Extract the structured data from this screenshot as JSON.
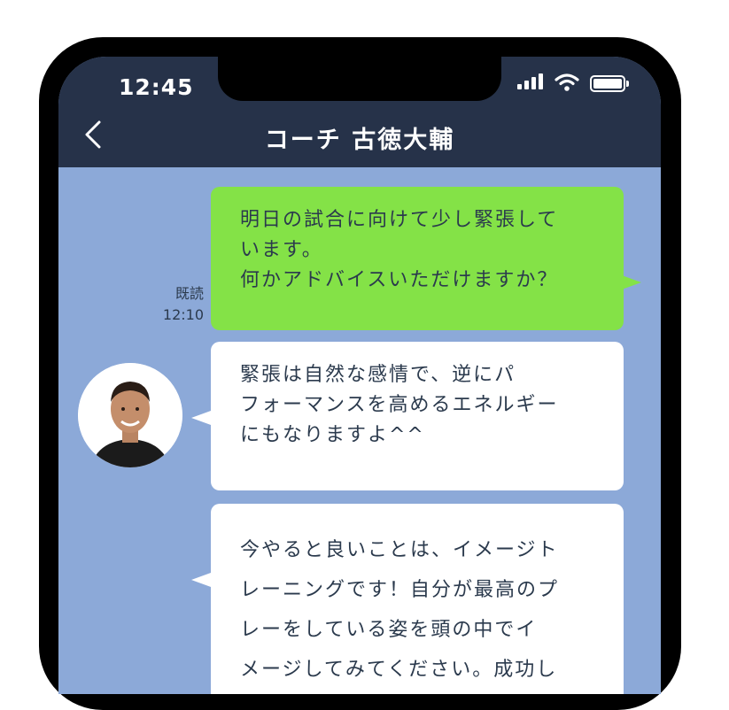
{
  "status_bar": {
    "time": "12:45"
  },
  "header": {
    "title": "コーチ 古徳大輔"
  },
  "messages": [
    {
      "side": "sent",
      "text": "明日の試合に向けて少し緊張して\nいます。\n何かアドバイスいただけますか？",
      "read_label": "既読",
      "time": "12:10"
    },
    {
      "side": "received",
      "text": "緊張は自然な感情で、逆にパ\nフォーマンスを高めるエネルギー\nにもなりますよ^^"
    },
    {
      "side": "received",
      "text": "今やると良いことは、イメージト\nレーニングです！自分が最高のプ\nレーをしている姿を頭の中でイ\nメージしてみてください。成功し"
    }
  ],
  "colors": {
    "chat_bg": "#8ca9d8",
    "header_bg": "#263249",
    "sent_bubble": "#84e247",
    "received_bubble": "#ffffff",
    "text": "#2b3a4d"
  }
}
